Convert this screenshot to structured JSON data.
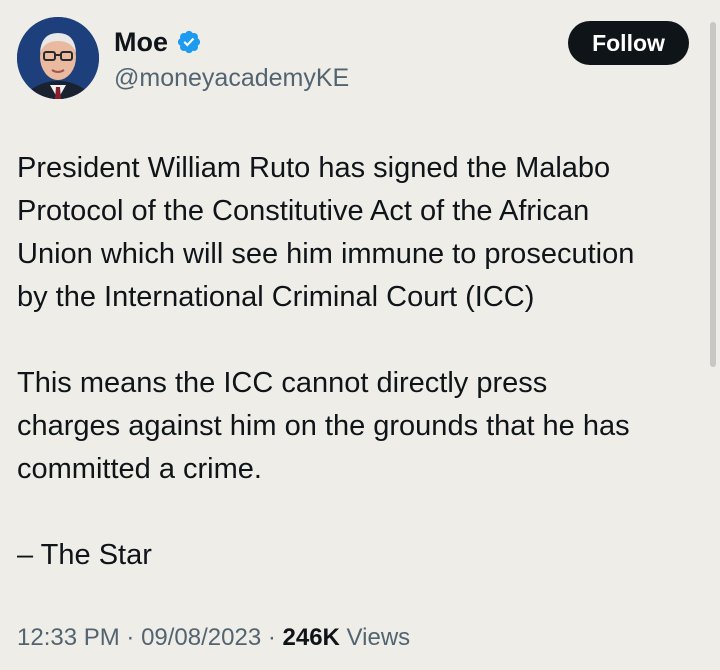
{
  "author": {
    "display_name": "Moe",
    "handle": "@moneyacademyKE",
    "verified_icon": "verified-badge-icon",
    "avatar_icon": "avatar-photo"
  },
  "actions": {
    "follow_label": "Follow"
  },
  "tweet": {
    "paragraph_1": "President William Ruto has signed the  Malabo\nProtocol of the Constitutive Act of the African\nUnion which will see him immune to prosecution\nby the International Criminal Court (ICC)",
    "paragraph_2": "This means the ICC cannot directly press\ncharges against him on the grounds that he has\ncommitted a crime.",
    "paragraph_3": "– The Star"
  },
  "meta": {
    "time": "12:33 PM",
    "separator": " · ",
    "date": "09/08/2023",
    "views_count": "246K",
    "views_label": " Views"
  },
  "colors": {
    "background": "#efede8",
    "text": "#0f1419",
    "muted": "#536471",
    "verified": "#1d9bf0",
    "button": "#0f1419"
  }
}
